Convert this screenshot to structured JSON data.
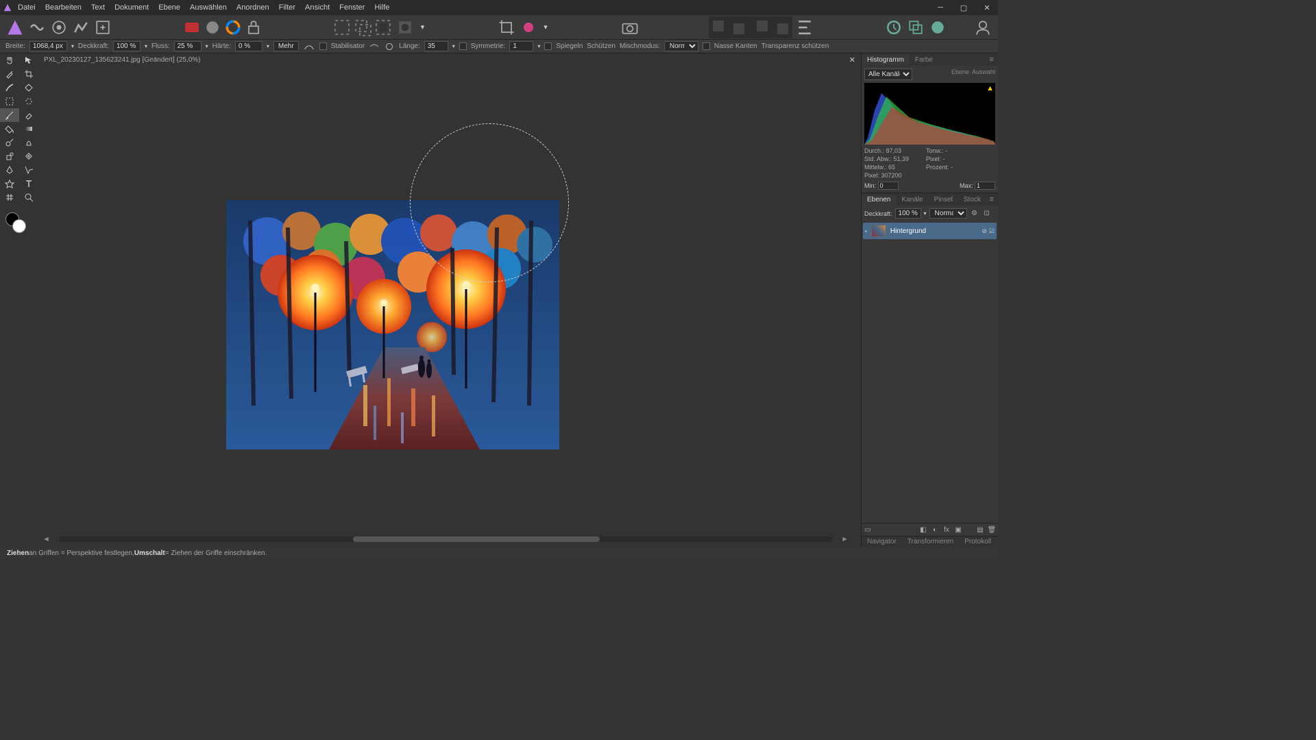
{
  "menu": [
    "Datei",
    "Bearbeiten",
    "Text",
    "Dokument",
    "Ebene",
    "Auswählen",
    "Anordnen",
    "Filter",
    "Ansicht",
    "Fenster",
    "Hilfe"
  ],
  "doc_tab": "PXL_20230127_135623241.jpg [Geändert] (25,0%)",
  "options": {
    "breite_label": "Breite:",
    "breite": "1068,4 px",
    "deckkraft_label": "Deckkraft:",
    "deckkraft": "100 %",
    "fluss_label": "Fluss:",
    "fluss": "25 %",
    "haerte_label": "Härte:",
    "haerte": "0 %",
    "mehr": "Mehr",
    "stabilisator": "Stabilisator",
    "laenge_label": "Länge:",
    "laenge": "35",
    "symmetrie_label": "Symmetrie:",
    "symmetrie": "1",
    "spiegeln": "Spiegeln",
    "schuetzen": "Schützen",
    "mischmodus_label": "Mischmodus:",
    "mischmodus": "Normal",
    "nasse_kanten": "Nasse Kanten",
    "transparenz": "Transparenz schützen"
  },
  "right": {
    "histo_tab": "Histogramm",
    "farbe_tab": "Farbe",
    "channels": "Alle Kanäle",
    "ebene_btn": "Ebene",
    "auswahl_btn": "Auswahl",
    "stats": {
      "durch": "Durch.: 87,03",
      "stdabw": "Std. Abw.: 51,39",
      "mittelw": "Mittelw.: 65",
      "pixel": "Pixel: 307200",
      "tonw": "Tonw.: -",
      "pixel2": "Pixel: -",
      "prozent": "Prozent: -"
    },
    "min_label": "Min:",
    "min": "0",
    "max_label": "Max:",
    "max": "1",
    "layers_tabs": [
      "Ebenen",
      "Kanäle",
      "Pinsel",
      "Stock"
    ],
    "layer_deckkraft_label": "Deckkraft:",
    "layer_deckkraft": "100 %",
    "layer_blend": "Normal",
    "layer_name": "Hintergrund",
    "bottom_tabs": [
      "Navigator",
      "Transformieren",
      "Protokoll"
    ]
  },
  "status": {
    "ziehen": "Ziehen",
    "text1": " an Griffen = Perspektive festlegen, ",
    "umschalt": "Umschalt",
    "text2": " = Ziehen der Griffe einschränken."
  }
}
